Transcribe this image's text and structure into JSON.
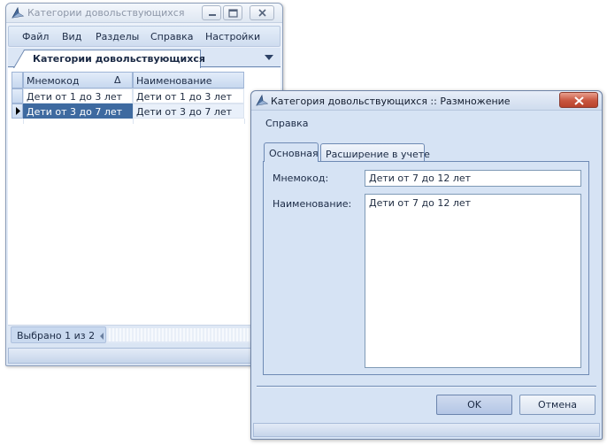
{
  "main_window": {
    "title": "Категории довольствующихся",
    "menu": [
      "Файл",
      "Вид",
      "Разделы",
      "Справка",
      "Настройки"
    ],
    "document_tab": "Категории довольствующихся",
    "grid": {
      "columns": [
        "Мнемокод",
        "Наименование"
      ],
      "sort_indicator": "Δ",
      "rows": [
        [
          "Дети от 1 до 3 лет",
          "Дети от 1 до 3 лет"
        ],
        [
          "Дети от 3 до 7 лет",
          "Дети от 3 до 7 лет"
        ]
      ],
      "selected_row": 1
    },
    "status_text": "Выбрано 1 из 2"
  },
  "dialog": {
    "title": "Категория довольствующихся :: Размножение",
    "menu": [
      "Справка"
    ],
    "tabs": [
      "Основная",
      "Расширение в учете"
    ],
    "active_tab": 0,
    "fields": {
      "mnemocode_label": "Мнемокод:",
      "mnemocode_value": "Дети от 7 до 12 лет",
      "name_label": "Наименование:",
      "name_value": "Дети от 7 до 12 лет"
    },
    "buttons": {
      "ok": "OK",
      "cancel": "Отмена"
    }
  },
  "colors": {
    "selection": "#3e6aa0",
    "window_bg": "#d6e3f4",
    "close_button": "#c8553e"
  }
}
